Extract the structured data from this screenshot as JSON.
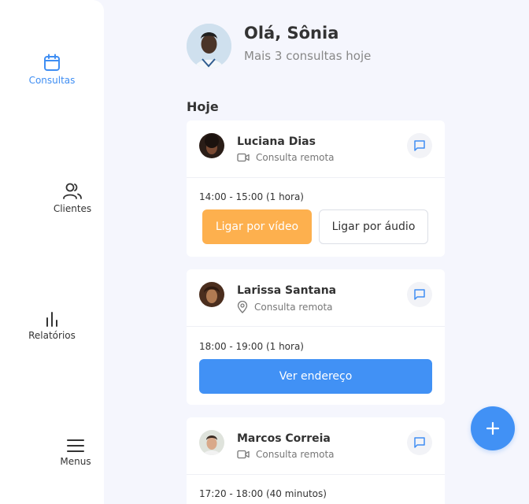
{
  "sidebar": {
    "items": [
      {
        "label": "Consultas",
        "icon": "calendar-icon",
        "active": true
      },
      {
        "label": "Clientes",
        "icon": "users-icon",
        "active": false
      },
      {
        "label": "Relatórios",
        "icon": "bar-chart-icon",
        "active": false
      },
      {
        "label": "Menus",
        "icon": "menu-icon",
        "active": false
      }
    ]
  },
  "header": {
    "greeting": "Olá, Sônia",
    "subtitle": "Mais 3 consultas hoje"
  },
  "section_title": "Hoje",
  "appointments": [
    {
      "name": "Luciana Dias",
      "type": "Consulta remota",
      "type_icon": "video-icon",
      "time": "14:00 - 15:00 (1 hora)",
      "buttons": [
        "Ligar por vídeo",
        "Ligar por áudio"
      ]
    },
    {
      "name": "Larissa Santana",
      "type": "Consulta remota",
      "type_icon": "location-pin-icon",
      "time": "18:00 - 19:00 (1 hora)",
      "buttons": [
        "Ver endereço"
      ]
    },
    {
      "name": "Marcos Correia",
      "type": "Consulta remota",
      "type_icon": "video-icon",
      "time": "17:20 - 18:00 (40 minutos)",
      "buttons": []
    }
  ],
  "colors": {
    "accent": "#4191f5",
    "orange": "#fdb04e",
    "background": "#f5f6fd"
  }
}
